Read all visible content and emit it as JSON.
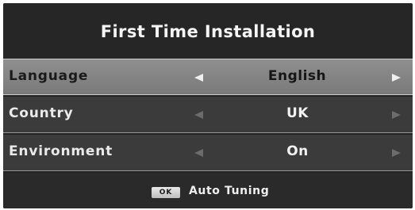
{
  "menu": {
    "title": "First Time Installation",
    "rows": [
      {
        "label": "Language",
        "value": "English",
        "selected": true
      },
      {
        "label": "Country",
        "value": "UK",
        "selected": false
      },
      {
        "label": "Environment",
        "value": "On",
        "selected": false
      }
    ]
  },
  "footer": {
    "ok_key": "OK",
    "action_label": "Auto Tuning"
  },
  "colors": {
    "background": "#232323",
    "selected_row": "#858585",
    "normal_row": "#3b3b3b",
    "text": "#f2f2f2"
  },
  "icons": {
    "left": "triangle-left-icon",
    "right": "triangle-right-icon"
  }
}
